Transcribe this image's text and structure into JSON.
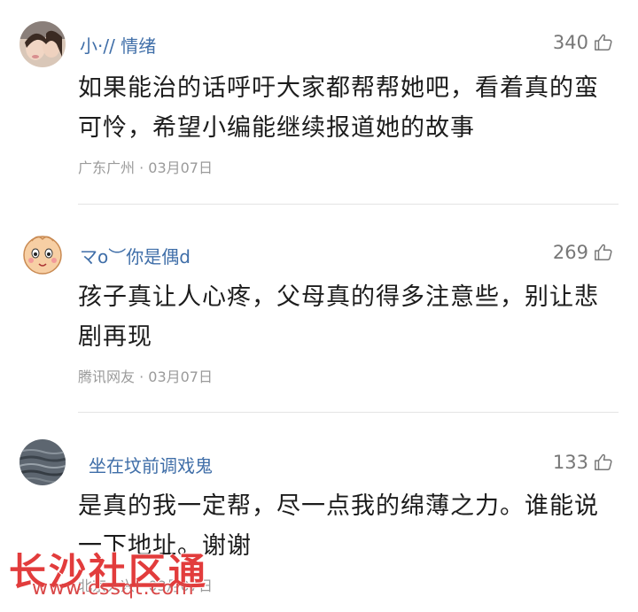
{
  "comments": [
    {
      "username": "小·// 情绪",
      "likes": "340",
      "text": "如果能治的话呼吁大家都帮帮她吧，看着真的蛮可怜，希望小编能继续报道她的故事",
      "meta": "广东广州 · 03月07日",
      "avatar_icon": "girls-photo-avatar"
    },
    {
      "username": "マo︶你是偶d",
      "likes": "269",
      "text": "孩子真让人心疼，父母真的得多注意些，别让悲剧再现",
      "meta": "腾讯网友 · 03月07日",
      "avatar_icon": "cartoon-face-avatar"
    },
    {
      "username": "坐在坟前调戏鬼",
      "likes": "133",
      "text": "是真的我一定帮，尽一点我的绵薄之力。谁能说一下地址。谢谢",
      "meta": "北京大兴 · 03月07日",
      "avatar_icon": "water-photo-avatar"
    }
  ],
  "watermark": {
    "title": "长沙社区通",
    "url": "www.cssqt.com"
  },
  "colors": {
    "username": "#3f6ea8",
    "text": "#1c1c1c",
    "meta": "#9a9a9a",
    "watermark": "#e23c3c"
  }
}
